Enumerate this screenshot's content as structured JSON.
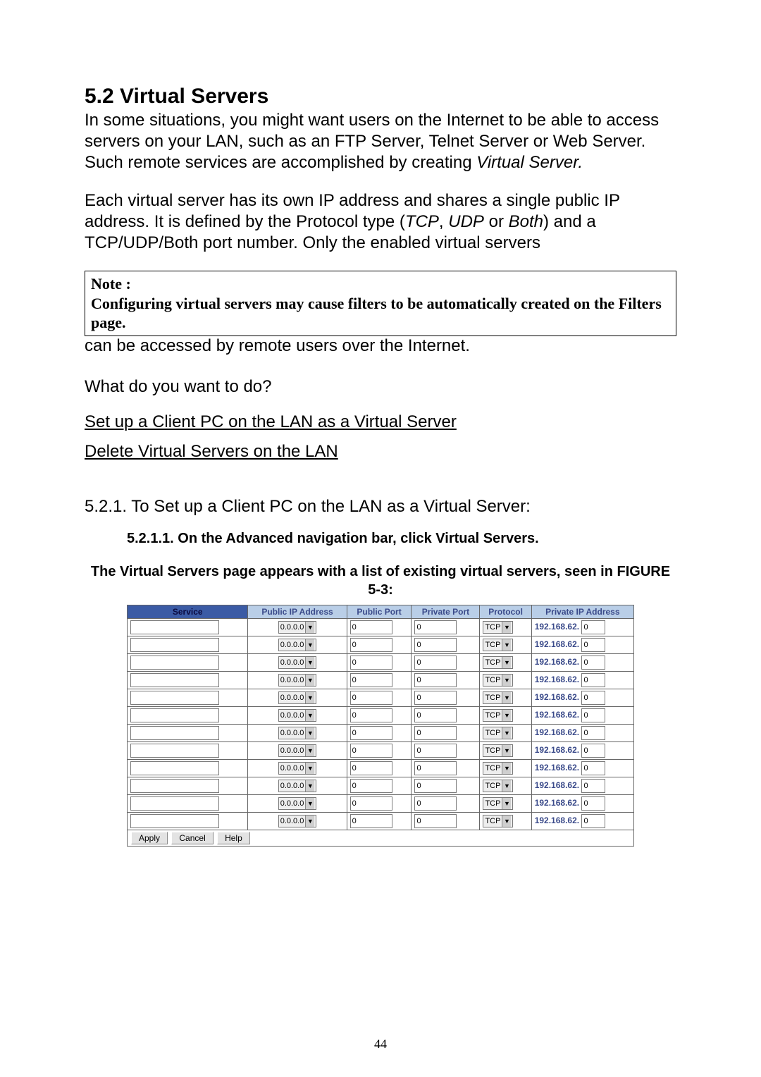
{
  "heading": "5.2 Virtual Servers",
  "para1_a": "In some situations, you might want users on the Internet to be able to access servers on your LAN, such as an FTP Server, Telnet Server or Web Server. Such remote services are accomplished by creating ",
  "para1_em": "Virtual Server.",
  "para2_a": "Each virtual server has its own IP address and shares a single public IP address. It is defined by the Protocol type (",
  "para2_em1": "TCP",
  "para2_b": ", ",
  "para2_em2": "UDP",
  "para2_c": " or ",
  "para2_em3": "Both",
  "para2_d": ") and a TCP/UDP/Both port number. Only the enabled virtual servers",
  "note_label": "Note :",
  "note_body": "Configuring virtual servers may cause filters to be automatically created on the Filters page.",
  "after_note": "can be accessed by remote users over the Internet.",
  "question": "What do you want to do?",
  "link1": "Set up a Client PC on the LAN as a Virtual Server",
  "link2": "Delete Virtual Servers on the LAN",
  "sub521": "5.2.1. To Set up a Client PC on the LAN as a Virtual Server:",
  "step_bold": "5.2.1.1. On the Advanced navigation bar, click Virtual Servers.",
  "caption": "The Virtual Servers page appears with a list of existing virtual servers, seen in FIGURE 5-3:",
  "table": {
    "headers": {
      "service": "Service",
      "pubip": "Public IP Address",
      "pubport": "Public Port",
      "privport": "Private Port",
      "proto": "Protocol",
      "privip": "Private IP Address"
    },
    "row_defaults": {
      "public_ip_selected": "0.0.0.0",
      "public_port": "0",
      "private_port": "0",
      "protocol_selected": "TCP",
      "private_ip_prefix": "192.168.62.",
      "private_ip_last": "0"
    },
    "row_count": 12,
    "buttons": {
      "apply": "Apply",
      "cancel": "Cancel",
      "help": "Help"
    }
  },
  "page_number": "44"
}
